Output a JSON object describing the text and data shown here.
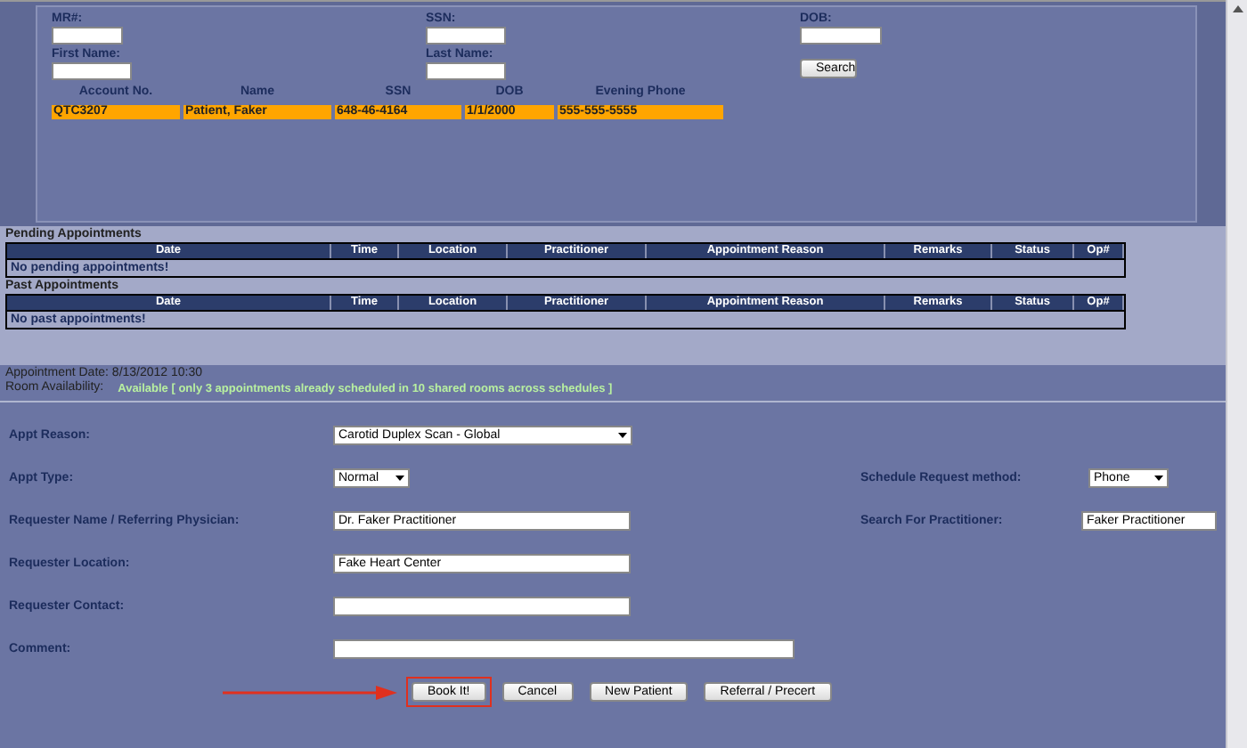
{
  "search": {
    "fields": [
      {
        "label": "MR#:"
      },
      {
        "label": "SSN:"
      },
      {
        "label": "DOB:"
      },
      {
        "label": "First Name:"
      },
      {
        "label": "Last Name:"
      }
    ],
    "button": "Search"
  },
  "results": {
    "columns": [
      "Account No.",
      "Name",
      "SSN",
      "DOB",
      "Evening Phone"
    ],
    "rows": [
      {
        "cells": [
          "QTC3207",
          "Patient, Faker",
          "648-46-4164",
          "1/1/2000",
          "555-555-5555"
        ],
        "selected": true
      }
    ]
  },
  "pending": {
    "title": "Pending Appointments",
    "columns": [
      "Date",
      "Time",
      "Location",
      "Practitioner",
      "Appointment Reason",
      "Remarks",
      "Status",
      "Op#"
    ],
    "empty": "No pending appointments!"
  },
  "past": {
    "title": "Past Appointments",
    "columns": [
      "Date",
      "Time",
      "Location",
      "Practitioner",
      "Appointment Reason",
      "Remarks",
      "Status",
      "Op#"
    ],
    "empty": "No past appointments!"
  },
  "appointment_date": "Appointment Date: 8/13/2012 10:30",
  "room": {
    "label": "Room Availability:",
    "value": "Available [ only 3 appointments already scheduled in 10 shared rooms across schedules ]"
  },
  "form": [
    {
      "label": "Appt Reason:",
      "kind": "select",
      "value": "Carotid Duplex Scan - Global"
    },
    {
      "label": "Appt Type:",
      "kind": "select",
      "value": "Normal",
      "right": {
        "label": "Schedule Request method:",
        "kind": "select",
        "value": "Phone"
      }
    },
    {
      "label": "Requester Name / Referring Physician:",
      "kind": "text",
      "value": "Dr. Faker Practitioner",
      "right": {
        "label": "Search For Practitioner:",
        "kind": "text",
        "value": "Faker Practitioner"
      }
    },
    {
      "label": "Requester Location:",
      "kind": "text",
      "value": "Fake Heart Center"
    },
    {
      "label": "Requester Contact:",
      "kind": "text"
    },
    {
      "label": "Comment:",
      "kind": "wide"
    }
  ],
  "buttons": [
    {
      "label": "Book It!",
      "highlighted": true
    },
    {
      "label": "Cancel",
      "highlighted": false
    },
    {
      "label": "New Patient",
      "highlighted": false
    },
    {
      "label": "Referral / Precert",
      "highlighted": false
    }
  ]
}
